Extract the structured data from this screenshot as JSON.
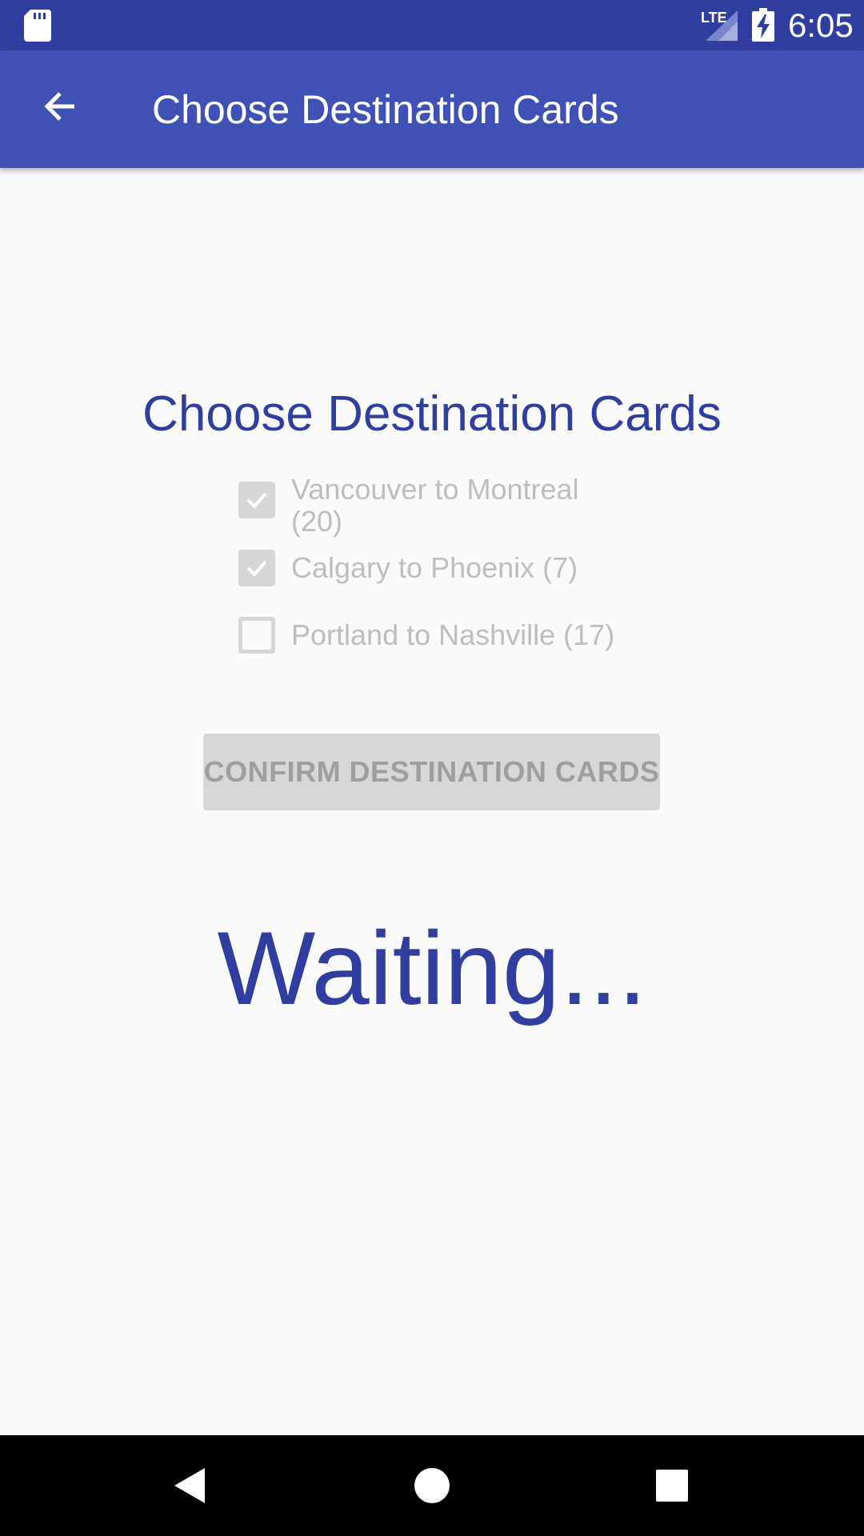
{
  "status_bar": {
    "network": "LTE",
    "time": "6:05",
    "icons": [
      "sd-card-icon",
      "signal-icon",
      "battery-charging-icon"
    ]
  },
  "toolbar": {
    "back_icon": "arrow-back-icon",
    "title": "Choose Destination Cards"
  },
  "content": {
    "title": "Choose Destination Cards",
    "cards": [
      {
        "label": "Vancouver to Montreal (20)",
        "checked": true
      },
      {
        "label": "Calgary to Phoenix (7)",
        "checked": true
      },
      {
        "label": "Portland to Nashville (17)",
        "checked": false
      }
    ],
    "confirm_label": "CONFIRM DESTINATION CARDS",
    "status_text": "Waiting..."
  },
  "nav_bar": {
    "icons": [
      "nav-back-icon",
      "nav-home-icon",
      "nav-recents-icon"
    ]
  },
  "colors": {
    "status_bar": "#303f9f",
    "app_bar": "#3f51b5",
    "accent_text": "#303f9f",
    "disabled": "#d6d6d6",
    "background": "#fafafa"
  }
}
